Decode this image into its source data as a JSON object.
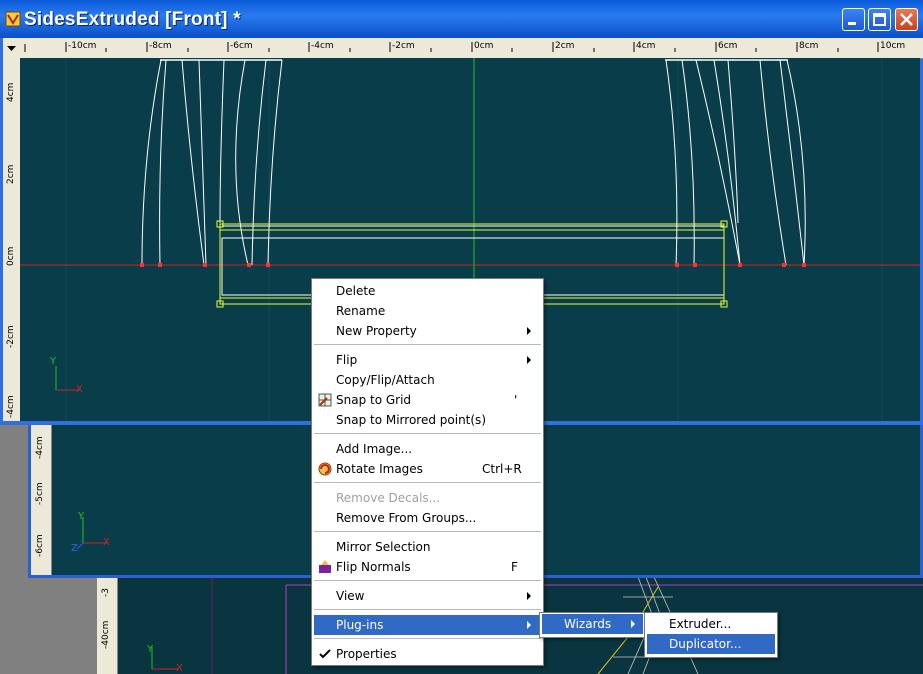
{
  "window": {
    "title": "SidesExtruded [Front] *",
    "buttons": {
      "minimize": "minimize-icon",
      "maximize": "maximize-icon",
      "close": "close-icon"
    }
  },
  "rulers": {
    "horizontal": [
      "-10cm",
      "-8cm",
      "-6cm",
      "-4cm",
      "-2cm",
      "0cm",
      "2cm",
      "4cm",
      "6cm",
      "8cm",
      "10cm"
    ],
    "vertical_main": [
      "4cm",
      "2cm",
      "0cm",
      "-2cm",
      "-4cm"
    ],
    "vertical_second": [
      "-4cm",
      "-5cm",
      "-6cm"
    ],
    "vertical_third": [
      "-3",
      "-40cm"
    ]
  },
  "axes": {
    "y": "Y",
    "x": "X",
    "z": "Z"
  },
  "context_menu": {
    "items": [
      {
        "label": "Delete"
      },
      {
        "label": "Rename"
      },
      {
        "label": "New Property",
        "submenu": true
      },
      {
        "label": "Flip",
        "submenu": true
      },
      {
        "label": "Copy/Flip/Attach"
      },
      {
        "label": "Snap to Grid",
        "icon": "snap-grid-icon",
        "shortcut": "'"
      },
      {
        "label": "Snap to Mirrored point(s)"
      },
      {
        "label": "Add Image..."
      },
      {
        "label": "Rotate Images",
        "icon": "rotate-images-icon",
        "shortcut": "Ctrl+R"
      },
      {
        "label": "Remove Decals...",
        "disabled": true
      },
      {
        "label": "Remove From Groups..."
      },
      {
        "label": "Mirror Selection"
      },
      {
        "label": "Flip Normals",
        "icon": "flip-normals-icon",
        "shortcut": "F"
      },
      {
        "label": "View",
        "submenu": true
      },
      {
        "label": "Plug-ins",
        "submenu": true,
        "selected": true
      },
      {
        "label": "Properties",
        "icon": "checkmark-icon"
      }
    ]
  },
  "wizards_menu": {
    "label": "Wizards"
  },
  "plugin_submenu": {
    "items": [
      {
        "label": "Extruder..."
      },
      {
        "label": "Duplicator..."
      }
    ]
  },
  "colors": {
    "viewport_bg": "#0a3d4a",
    "title_bar": "#0a5ad8",
    "menu_highlight": "#316ac5",
    "wire_white": "#ffffff",
    "wire_yellow": "#e8ff33",
    "axis_red": "#d02020",
    "axis_green": "#22c022",
    "mesh_magenta": "#b040c0"
  }
}
